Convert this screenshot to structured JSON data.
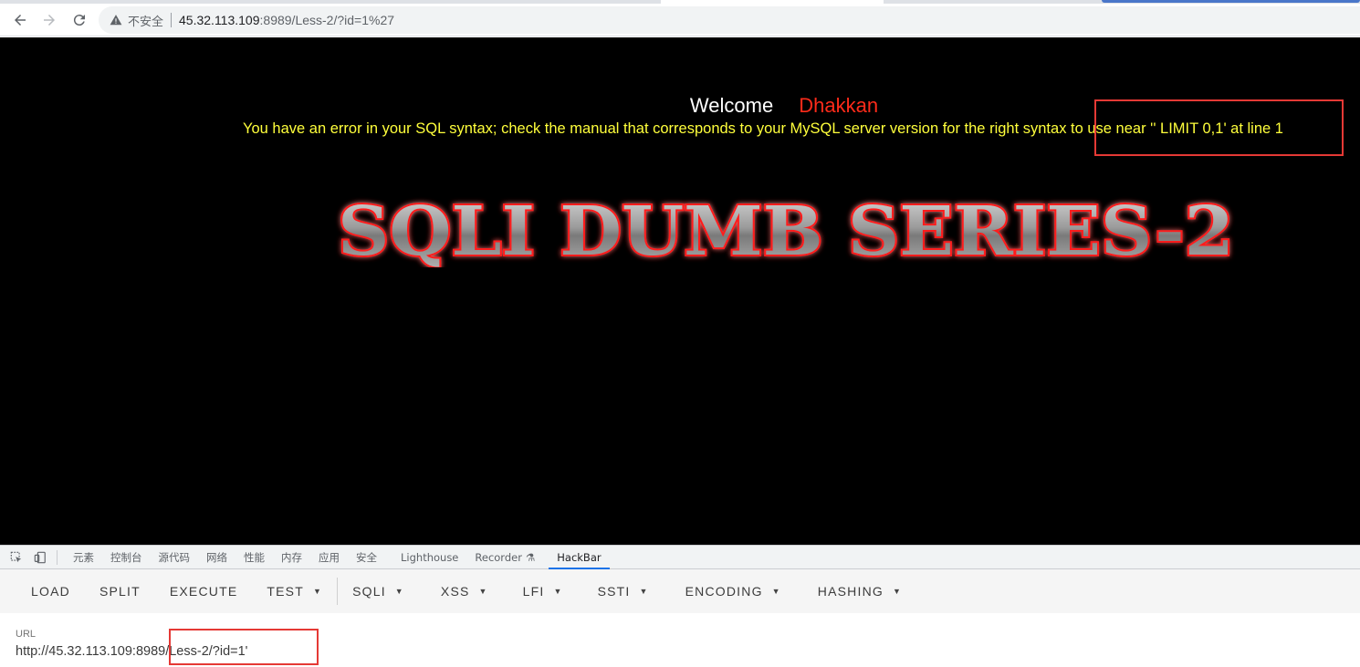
{
  "browser": {
    "security_label": "不安全",
    "url_host": "45.32.113.109",
    "url_rest": ":8989/Less-2/?id=1%27"
  },
  "page": {
    "welcome": "Welcome",
    "username": "Dhakkan",
    "error_message": "You have an error in your SQL syntax; check the manual that corresponds to your MySQL server version for the right syntax to use near '' LIMIT 0,1' at line 1",
    "banner": "SQLI DUMB SERIES-2"
  },
  "devtools": {
    "tabs": [
      "元素",
      "控制台",
      "源代码",
      "网络",
      "性能",
      "内存",
      "应用",
      "安全",
      "Lighthouse",
      "Recorder",
      "HackBar"
    ],
    "active_tab": "HackBar"
  },
  "hackbar": {
    "buttons": [
      {
        "label": "LOAD",
        "dropdown": false
      },
      {
        "label": "SPLIT",
        "dropdown": false
      },
      {
        "label": "EXECUTE",
        "dropdown": false
      },
      {
        "label": "TEST",
        "dropdown": true
      },
      {
        "label": "SQLI",
        "dropdown": true
      },
      {
        "label": "XSS",
        "dropdown": true
      },
      {
        "label": "LFI",
        "dropdown": true
      },
      {
        "label": "SSTI",
        "dropdown": true
      },
      {
        "label": "ENCODING",
        "dropdown": true
      },
      {
        "label": "HASHING",
        "dropdown": true
      }
    ],
    "url_label": "URL",
    "url_value": "http://45.32.113.109:8989/Less-2/?id=1'"
  },
  "colors": {
    "page_bg": "#000000",
    "error_text": "#ffff3b",
    "username": "#ff2b1a",
    "annotation_box": "#e53935"
  }
}
